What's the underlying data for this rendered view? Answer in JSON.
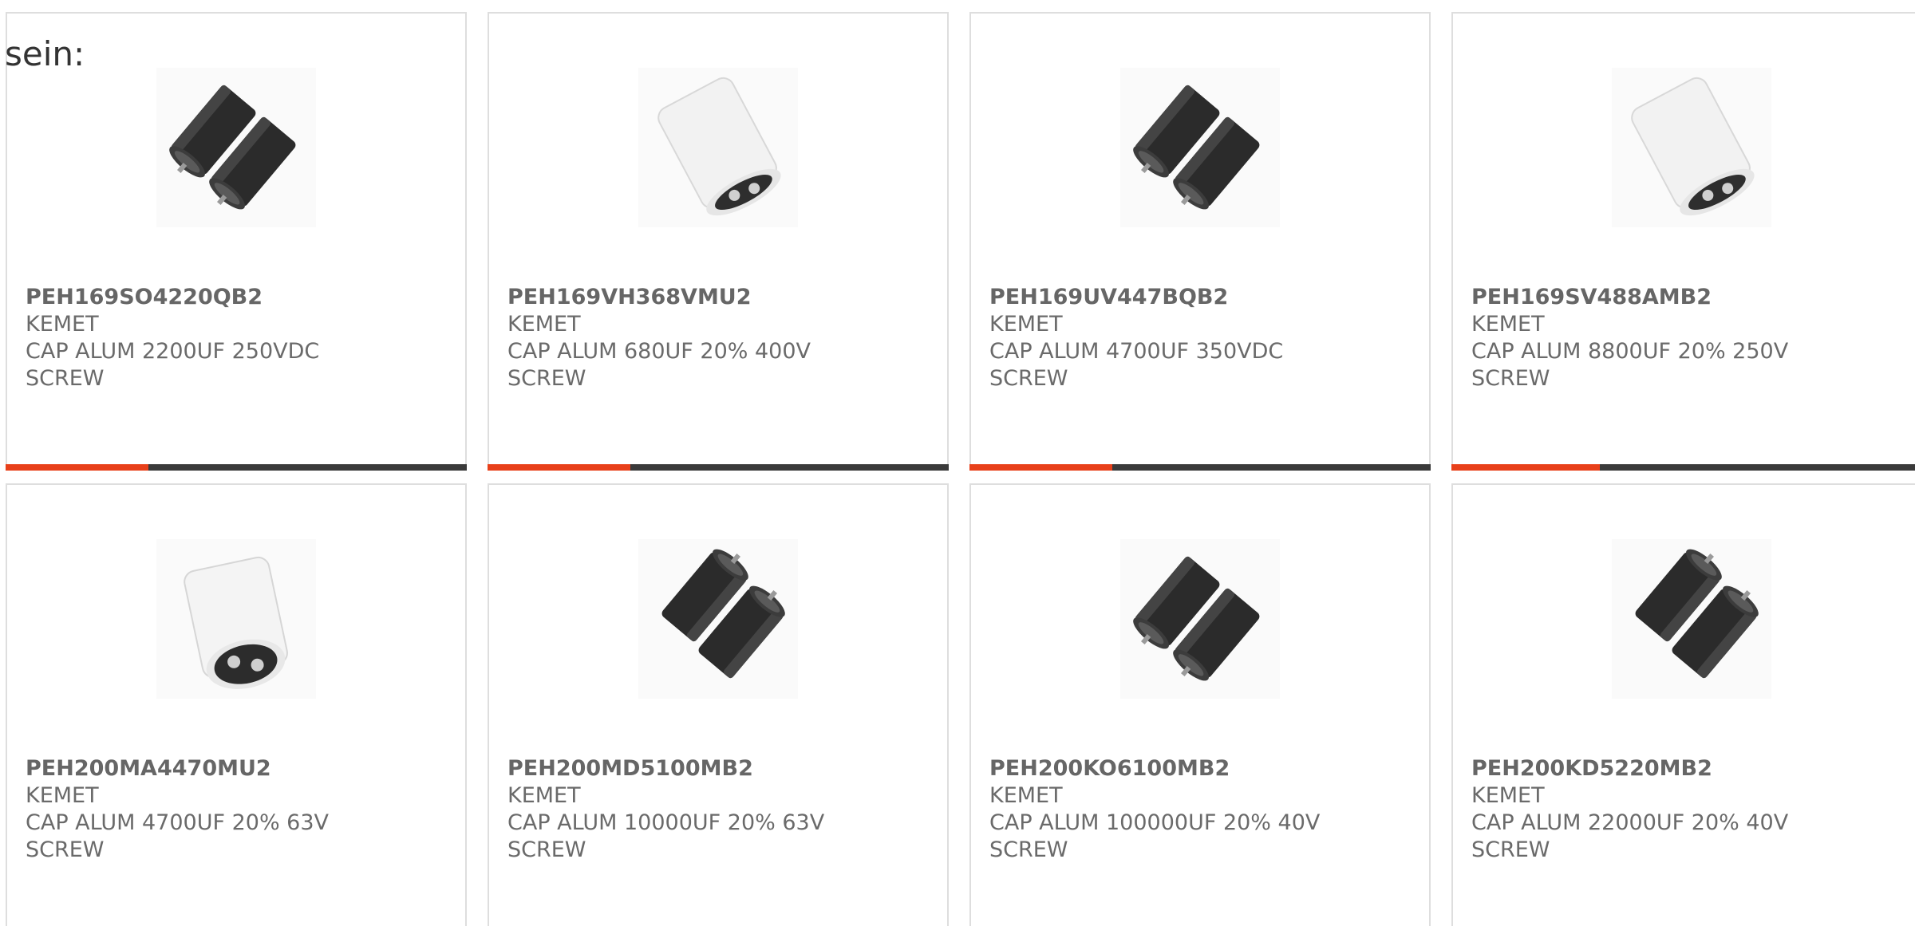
{
  "intro": {
    "text": "sein:"
  },
  "colors": {
    "accent": "#e8401a",
    "bar_track": "#3a3a3a",
    "border": "#dedede",
    "text": "#6a6a6a"
  },
  "products": [
    {
      "part_number": "PEH169SO4220QB2",
      "manufacturer": "KEMET",
      "description_line1": "CAP ALUM 2200UF 250VDC",
      "description_line2": "SCREW",
      "image_icon": "black-capacitor-pair-icon",
      "image_variant": "black-pair-left",
      "progress": 0.31
    },
    {
      "part_number": "PEH169VH368VMU2",
      "manufacturer": "KEMET",
      "description_line1": "CAP ALUM 680UF 20% 400V",
      "description_line2": "SCREW",
      "image_icon": "white-capacitor-icon",
      "image_variant": "white-tilt",
      "progress": 0.31
    },
    {
      "part_number": "PEH169UV447BQB2",
      "manufacturer": "KEMET",
      "description_line1": "CAP ALUM 4700UF 350VDC",
      "description_line2": "SCREW",
      "image_icon": "black-capacitor-pair-icon",
      "image_variant": "black-pair-left",
      "progress": 0.31
    },
    {
      "part_number": "PEH169SV488AMB2",
      "manufacturer": "KEMET",
      "description_line1": "CAP ALUM 8800UF 20% 250V",
      "description_line2": "SCREW",
      "image_icon": "white-capacitor-icon",
      "image_variant": "white-tilt",
      "progress": 0.31
    },
    {
      "part_number": "PEH200MA4470MU2",
      "manufacturer": "KEMET",
      "description_line1": "CAP ALUM 4700UF 20% 63V",
      "description_line2": "SCREW",
      "image_icon": "white-capacitor-icon",
      "image_variant": "white-front",
      "progress": null
    },
    {
      "part_number": "PEH200MD5100MB2",
      "manufacturer": "KEMET",
      "description_line1": "CAP ALUM 10000UF 20% 63V",
      "description_line2": "SCREW",
      "image_icon": "black-capacitor-pair-icon",
      "image_variant": "black-pair-right",
      "progress": null
    },
    {
      "part_number": "PEH200KO6100MB2",
      "manufacturer": "KEMET",
      "description_line1": "CAP ALUM 100000UF 20% 40V",
      "description_line2": "SCREW",
      "image_icon": "black-capacitor-pair-icon",
      "image_variant": "black-pair-left",
      "progress": null
    },
    {
      "part_number": "PEH200KD5220MB2",
      "manufacturer": "KEMET",
      "description_line1": "CAP ALUM 22000UF 20% 40V",
      "description_line2": "SCREW",
      "image_icon": "black-capacitor-pair-icon",
      "image_variant": "black-pair-right",
      "progress": null
    }
  ]
}
